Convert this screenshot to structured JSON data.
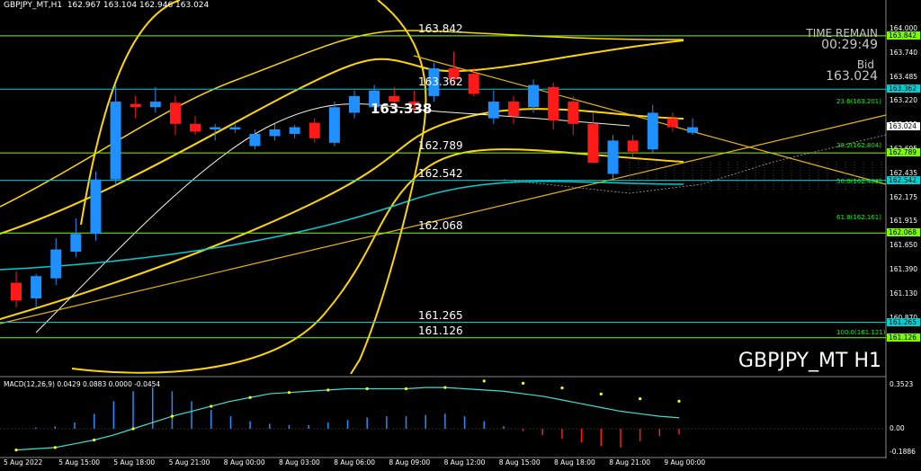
{
  "header": {
    "symbol": "GBPJPY_MT,H1",
    "ohlc": "162.967 163.104 162.946 163.024"
  },
  "title": "GBPJPY_MT H1",
  "time_remain": {
    "label": "TIME REMAIN",
    "value": "00:29:49"
  },
  "bid": {
    "label": "Bid",
    "value": "163.024"
  },
  "levels": [
    {
      "label": "163.842",
      "price": 163.842,
      "color": "#7CFC00"
    },
    {
      "label": "163.362",
      "price": 163.362,
      "color": "#00CED1"
    },
    {
      "label": "162.789",
      "price": 162.789,
      "color": "#7CFC00"
    },
    {
      "label": "162.542",
      "price": 162.542,
      "color": "#00CED1"
    },
    {
      "label": "162.068",
      "price": 162.068,
      "color": "#7CFC00"
    },
    {
      "label": "161.265",
      "price": 161.265,
      "color": "#00CED1"
    },
    {
      "label": "161.126",
      "price": 161.126,
      "color": "#7CFC00"
    }
  ],
  "current_price_label": "163.338",
  "fib": [
    {
      "label": "23.6(163.201)",
      "price": 163.201
    },
    {
      "label": "38.2(162.804)",
      "price": 162.804
    },
    {
      "label": "50.0(162.483)",
      "price": 162.483
    },
    {
      "label": "61.8(162.161)",
      "price": 162.161
    },
    {
      "label": "100.0(161.121)",
      "price": 161.121
    }
  ],
  "y_axis": {
    "ticks": [
      "164.000",
      "163.740",
      "163.485",
      "163.220",
      "162.955",
      "162.695",
      "162.435",
      "162.175",
      "161.915",
      "161.650",
      "161.390",
      "161.130",
      "160.870"
    ],
    "tags": [
      {
        "label": "163.842",
        "price": 163.842,
        "color": "#7CFC00"
      },
      {
        "label": "163.362",
        "price": 163.362,
        "color": "#00CED1"
      },
      {
        "label": "163.024",
        "price": 163.024,
        "color": "#ffffff"
      },
      {
        "label": "162.789",
        "price": 162.789,
        "color": "#7CFC00"
      },
      {
        "label": "162.542",
        "price": 162.542,
        "color": "#00CED1"
      },
      {
        "label": "162.068",
        "price": 162.068,
        "color": "#7CFC00"
      },
      {
        "label": "161.265",
        "price": 161.265,
        "color": "#00CED1"
      },
      {
        "label": "161.126",
        "price": 161.126,
        "color": "#7CFC00"
      }
    ]
  },
  "x_axis": [
    "5 Aug 2022",
    "5 Aug 15:00",
    "5 Aug 18:00",
    "5 Aug 21:00",
    "8 Aug 00:00",
    "8 Aug 03:00",
    "8 Aug 06:00",
    "8 Aug 09:00",
    "8 Aug 12:00",
    "8 Aug 15:00",
    "8 Aug 18:00",
    "8 Aug 21:00",
    "9 Aug 00:00"
  ],
  "macd": {
    "label": "MACD(12,26,9) 0.0429 0.0883 0.0000 -0.0454",
    "ticks": [
      "0.3523",
      "0.00",
      "-0.1886"
    ]
  },
  "chart_data": {
    "type": "candlestick",
    "ylim": [
      160.8,
      164.1
    ],
    "candles": [
      {
        "o": 161.62,
        "h": 161.72,
        "l": 161.4,
        "c": 161.46
      },
      {
        "o": 161.48,
        "h": 161.7,
        "l": 161.4,
        "c": 161.68
      },
      {
        "o": 161.66,
        "h": 162.02,
        "l": 161.6,
        "c": 161.92
      },
      {
        "o": 161.9,
        "h": 162.2,
        "l": 161.85,
        "c": 162.06
      },
      {
        "o": 162.06,
        "h": 162.62,
        "l": 162.0,
        "c": 162.55
      },
      {
        "o": 162.55,
        "h": 163.4,
        "l": 162.5,
        "c": 163.25
      },
      {
        "o": 163.23,
        "h": 163.3,
        "l": 163.1,
        "c": 163.2
      },
      {
        "o": 163.2,
        "h": 163.38,
        "l": 163.15,
        "c": 163.25
      },
      {
        "o": 163.24,
        "h": 163.3,
        "l": 162.95,
        "c": 163.05
      },
      {
        "o": 163.05,
        "h": 163.12,
        "l": 162.95,
        "c": 162.98
      },
      {
        "o": 163.0,
        "h": 163.05,
        "l": 162.9,
        "c": 163.02
      },
      {
        "o": 163.0,
        "h": 163.05,
        "l": 162.97,
        "c": 163.02
      },
      {
        "o": 162.85,
        "h": 163.0,
        "l": 162.82,
        "c": 162.96
      },
      {
        "o": 162.94,
        "h": 163.05,
        "l": 162.9,
        "c": 163.0
      },
      {
        "o": 162.96,
        "h": 163.04,
        "l": 162.92,
        "c": 163.02
      },
      {
        "o": 163.06,
        "h": 163.1,
        "l": 162.88,
        "c": 162.92
      },
      {
        "o": 162.88,
        "h": 163.25,
        "l": 162.85,
        "c": 163.2
      },
      {
        "o": 163.15,
        "h": 163.35,
        "l": 163.1,
        "c": 163.3
      },
      {
        "o": 163.2,
        "h": 163.4,
        "l": 163.15,
        "c": 163.35
      },
      {
        "o": 163.3,
        "h": 163.38,
        "l": 163.2,
        "c": 163.25
      },
      {
        "o": 163.25,
        "h": 163.35,
        "l": 163.15,
        "c": 163.22
      },
      {
        "o": 163.3,
        "h": 163.6,
        "l": 163.25,
        "c": 163.55
      },
      {
        "o": 163.55,
        "h": 163.7,
        "l": 163.4,
        "c": 163.45
      },
      {
        "o": 163.5,
        "h": 163.55,
        "l": 163.3,
        "c": 163.32
      },
      {
        "o": 163.1,
        "h": 163.35,
        "l": 163.05,
        "c": 163.25
      },
      {
        "o": 163.25,
        "h": 163.3,
        "l": 163.05,
        "c": 163.12
      },
      {
        "o": 163.2,
        "h": 163.45,
        "l": 163.15,
        "c": 163.4
      },
      {
        "o": 163.38,
        "h": 163.42,
        "l": 163.0,
        "c": 163.08
      },
      {
        "o": 163.25,
        "h": 163.3,
        "l": 162.95,
        "c": 163.05
      },
      {
        "o": 163.05,
        "h": 163.15,
        "l": 162.8,
        "c": 162.7
      },
      {
        "o": 162.6,
        "h": 162.95,
        "l": 162.55,
        "c": 162.9
      },
      {
        "o": 162.9,
        "h": 162.95,
        "l": 162.75,
        "c": 162.8
      },
      {
        "o": 162.82,
        "h": 163.22,
        "l": 162.78,
        "c": 163.15
      },
      {
        "o": 163.1,
        "h": 163.15,
        "l": 162.98,
        "c": 163.02
      },
      {
        "o": 162.97,
        "h": 163.1,
        "l": 162.95,
        "c": 163.02
      }
    ],
    "macd_hist": [
      0.0,
      0.01,
      0.02,
      0.05,
      0.12,
      0.22,
      0.3,
      0.33,
      0.3,
      0.22,
      0.15,
      0.1,
      0.06,
      0.04,
      0.03,
      0.03,
      0.05,
      0.07,
      0.09,
      0.1,
      0.1,
      0.11,
      0.12,
      0.1,
      0.06,
      0.02,
      -0.02,
      -0.05,
      -0.08,
      -0.11,
      -0.14,
      -0.15,
      -0.1,
      -0.06,
      -0.045
    ],
    "macd_signal": [
      -0.17,
      -0.16,
      -0.15,
      -0.12,
      -0.09,
      -0.05,
      0.0,
      0.05,
      0.1,
      0.14,
      0.18,
      0.22,
      0.25,
      0.28,
      0.29,
      0.3,
      0.31,
      0.32,
      0.32,
      0.32,
      0.32,
      0.33,
      0.33,
      0.32,
      0.31,
      0.3,
      0.28,
      0.26,
      0.23,
      0.2,
      0.17,
      0.14,
      0.12,
      0.1,
      0.088
    ]
  }
}
